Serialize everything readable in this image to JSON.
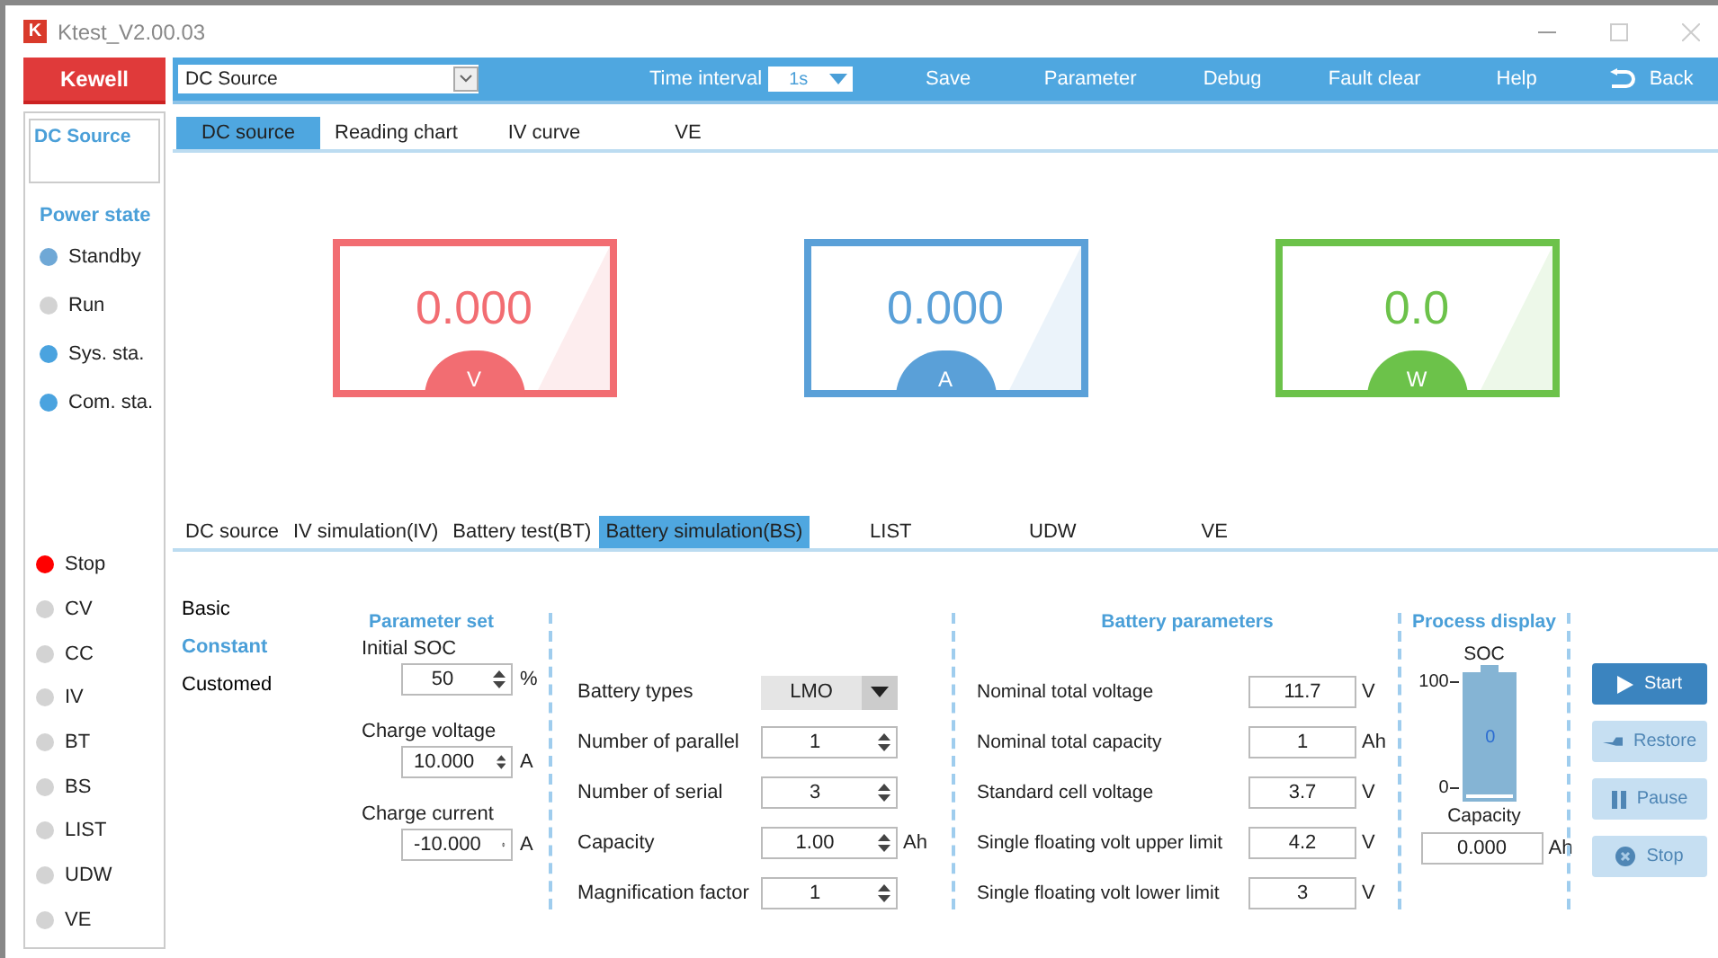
{
  "window": {
    "app_icon": "K",
    "title": "Ktest_V2.00.03"
  },
  "brand": "Kewell",
  "toolbar": {
    "mode_select": "DC Source",
    "time_interval_label": "Time interval",
    "time_interval": "1s",
    "buttons": [
      "Save",
      "Parameter",
      "Debug",
      "Fault clear",
      "Help"
    ],
    "back": "Back"
  },
  "sidebar": {
    "source": "DC Source",
    "power_state_title": "Power state",
    "power_states": [
      {
        "label": "Standby",
        "color": "#6fa8d6"
      },
      {
        "label": "Run",
        "color": "#d3d3d3"
      },
      {
        "label": "Sys. sta.",
        "color": "#4aa3df"
      },
      {
        "label": "Com. sta.",
        "color": "#4aa3df"
      }
    ],
    "modes": [
      {
        "label": "Stop",
        "color": "#ff0000"
      },
      {
        "label": "CV",
        "color": "#d3d3d3"
      },
      {
        "label": "CC",
        "color": "#d3d3d3"
      },
      {
        "label": "IV",
        "color": "#d3d3d3"
      },
      {
        "label": "BT",
        "color": "#d3d3d3"
      },
      {
        "label": "BS",
        "color": "#d3d3d3"
      },
      {
        "label": "LIST",
        "color": "#d3d3d3"
      },
      {
        "label": "UDW",
        "color": "#d3d3d3"
      },
      {
        "label": "VE",
        "color": "#d3d3d3"
      }
    ]
  },
  "top_tabs": [
    {
      "label": "DC source",
      "selected": true
    },
    {
      "label": "Reading chart",
      "selected": false
    },
    {
      "label": "IV curve",
      "selected": false
    },
    {
      "label": "VE",
      "selected": false
    }
  ],
  "gauges": [
    {
      "value": "0.000",
      "unit": "V",
      "color": "#f26d72"
    },
    {
      "value": "0.000",
      "unit": "A",
      "color": "#5aa0d8"
    },
    {
      "value": "0.0",
      "unit": "W",
      "color": "#6cc24a"
    }
  ],
  "function_tabs": [
    {
      "label": "DC source",
      "selected": false
    },
    {
      "label": "IV simulation(IV)",
      "selected": false
    },
    {
      "label": "Battery test(BT)",
      "selected": false
    },
    {
      "label": "Battery simulation(BS)",
      "selected": true
    },
    {
      "label": "LIST",
      "selected": false
    },
    {
      "label": "UDW",
      "selected": false
    },
    {
      "label": "VE",
      "selected": false
    }
  ],
  "mode_nav": [
    {
      "label": "Basic",
      "selected": false
    },
    {
      "label": "Constant",
      "selected": true
    },
    {
      "label": "Customed",
      "selected": false
    }
  ],
  "parameter_set": {
    "title": "Parameter set",
    "fields": [
      {
        "label": "Initial SOC",
        "value": "50",
        "unit": "%"
      },
      {
        "label": "Charge voltage",
        "value": "10.000",
        "unit": "A"
      },
      {
        "label": "Charge current",
        "value": "-10.000",
        "unit": "A"
      }
    ]
  },
  "battery_setup": [
    {
      "label": "Battery types",
      "kind": "select",
      "value": "LMO"
    },
    {
      "label": "Number of parallel",
      "kind": "spin",
      "value": "1"
    },
    {
      "label": "Number of serial",
      "kind": "spin",
      "value": "3"
    },
    {
      "label": "Capacity",
      "kind": "spin",
      "value": "1.00",
      "unit": "Ah"
    },
    {
      "label": "Magnification factor",
      "kind": "spin",
      "value": "1"
    }
  ],
  "battery_parameters": {
    "title": "Battery parameters",
    "fields": [
      {
        "label": "Nominal total voltage",
        "value": "11.7",
        "unit": "V"
      },
      {
        "label": "Nominal total capacity",
        "value": "1",
        "unit": "Ah"
      },
      {
        "label": "Standard cell voltage",
        "value": "3.7",
        "unit": "V"
      },
      {
        "label": "Single floating volt upper limit",
        "value": "4.2",
        "unit": "V"
      },
      {
        "label": "Single floating volt lower limit",
        "value": "3",
        "unit": "V"
      }
    ]
  },
  "process_display": {
    "title": "Process display",
    "soc_label": "SOC",
    "axis_max": "100",
    "axis_min": "0",
    "level": 0,
    "soc_value": "0",
    "capacity_label": "Capacity",
    "capacity": "0.000",
    "capacity_unit": "Ah"
  },
  "actions": [
    {
      "label": "Start",
      "kind": "play",
      "disabled": false
    },
    {
      "label": "Restore",
      "kind": "restore",
      "disabled": true
    },
    {
      "label": "Pause",
      "kind": "pause",
      "disabled": true
    },
    {
      "label": "Stop",
      "kind": "stop",
      "disabled": true
    }
  ]
}
